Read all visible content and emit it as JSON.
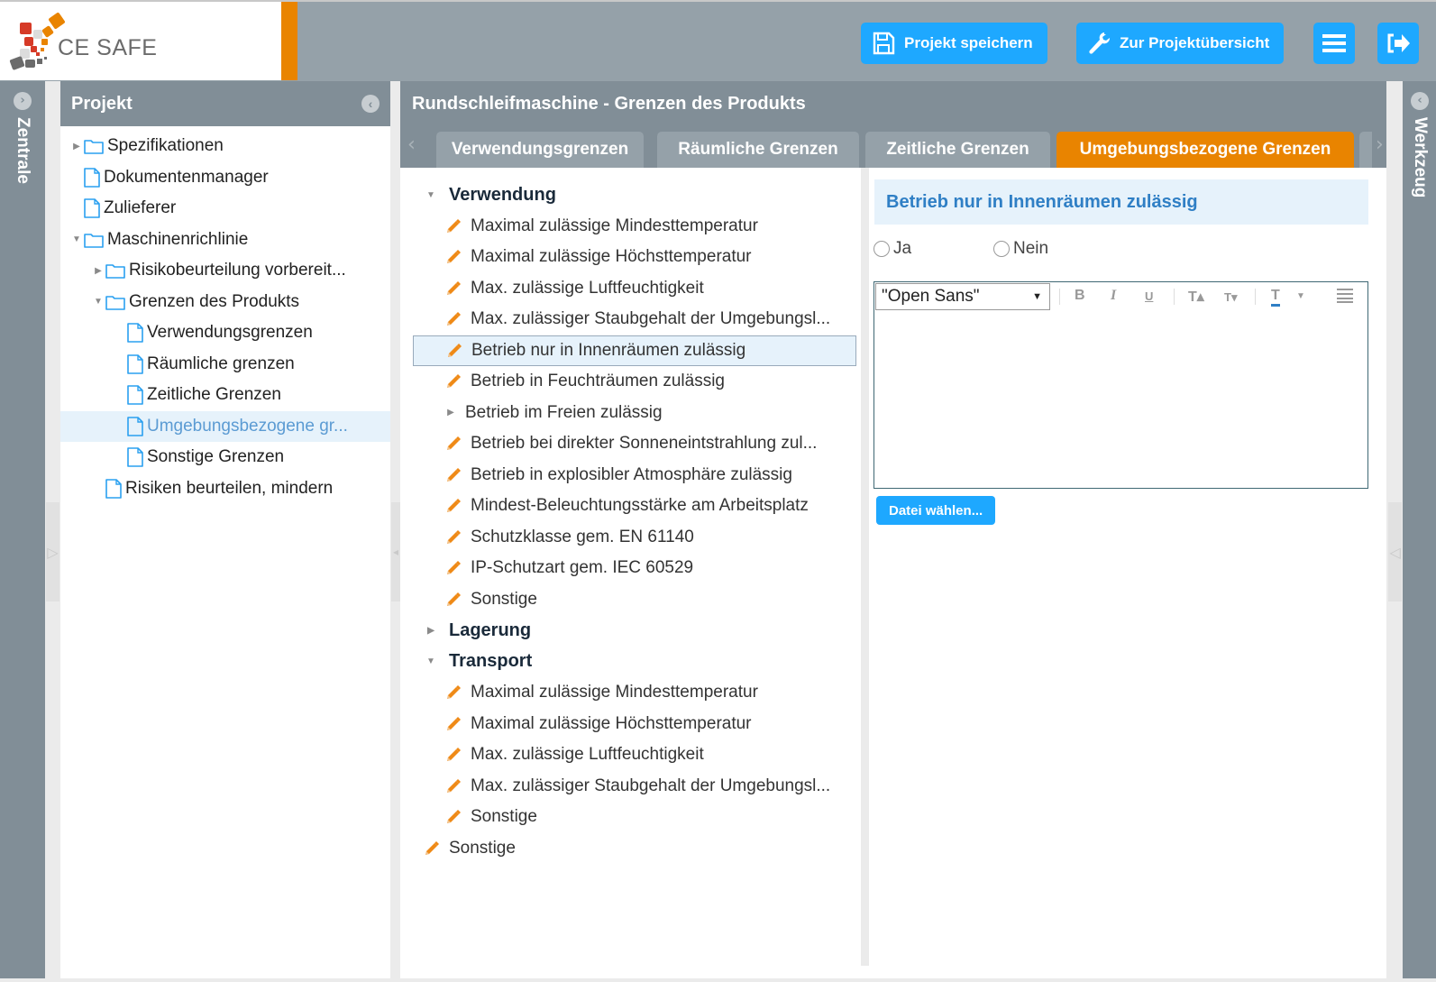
{
  "app": {
    "logo_text": "CE SAFE"
  },
  "toolbar": {
    "save_label": "Projekt speichern",
    "overview_label": "Zur Projektübersicht",
    "menu_icon": "hamburger-menu-icon",
    "logout_icon": "sign-out-icon"
  },
  "left_strip": {
    "label": "Zentrale",
    "toggle_icon": "chevron-right-circle-icon"
  },
  "right_strip": {
    "label": "Werkzeug",
    "toggle_icon": "chevron-left-circle-icon"
  },
  "project_panel": {
    "title": "Projekt",
    "collapse_icon": "chevron-left-circle-icon",
    "tree": [
      {
        "label": "Spezifikationen",
        "type": "folder",
        "level": 0,
        "caret": "collapsed"
      },
      {
        "label": "Dokumentenmanager",
        "type": "file",
        "level": 0,
        "caret": "none"
      },
      {
        "label": "Zulieferer",
        "type": "file",
        "level": 0,
        "caret": "none"
      },
      {
        "label": "Maschinenrichlinie",
        "type": "folder",
        "level": 0,
        "caret": "expanded"
      },
      {
        "label": "Risikobeurteilung vorbereit...",
        "type": "folder",
        "level": 1,
        "caret": "collapsed"
      },
      {
        "label": "Grenzen des Produkts",
        "type": "folder",
        "level": 1,
        "caret": "expanded"
      },
      {
        "label": "Verwendungsgrenzen",
        "type": "file",
        "level": 2,
        "caret": "none"
      },
      {
        "label": "Räumliche grenzen",
        "type": "file",
        "level": 2,
        "caret": "none"
      },
      {
        "label": "Zeitliche Grenzen",
        "type": "file",
        "level": 2,
        "caret": "none"
      },
      {
        "label": "Umgebungsbezogene gr...",
        "type": "file",
        "level": 2,
        "caret": "none",
        "selected": true
      },
      {
        "label": "Sonstige Grenzen",
        "type": "file",
        "level": 2,
        "caret": "none"
      },
      {
        "label": "Risiken beurteilen, mindern",
        "type": "file",
        "level": 1,
        "caret": "none"
      }
    ]
  },
  "main": {
    "title": "Rundschleifmaschine - Grenzen des Produkts",
    "tabs": [
      {
        "label": "Verwendungsgrenzen",
        "active": false
      },
      {
        "label": "Räumliche Grenzen",
        "active": false
      },
      {
        "label": "Zeitliche Grenzen",
        "active": false
      },
      {
        "label": "Umgebungsbezogene Grenzen",
        "active": true
      }
    ],
    "items": [
      {
        "label": "Verwendung",
        "kind": "group",
        "caret": "expanded",
        "level": 0
      },
      {
        "label": "Maximal zulässige Mindesttemperatur",
        "kind": "item",
        "level": 1
      },
      {
        "label": "Maximal zulässige Höchsttemperatur",
        "kind": "item",
        "level": 1
      },
      {
        "label": "Max. zulässige Luftfeuchtigkeit",
        "kind": "item",
        "level": 1
      },
      {
        "label": "Max. zulässiger Staubgehalt der Umgebungsl...",
        "kind": "item",
        "level": 1
      },
      {
        "label": "Betrieb nur in Innenräumen zulässig",
        "kind": "item",
        "level": 1,
        "selected": true
      },
      {
        "label": "Betrieb in Feuchträumen zulässig",
        "kind": "item",
        "level": 1
      },
      {
        "label": "Betrieb im Freien zulässig",
        "kind": "subgroup",
        "caret": "collapsed",
        "level": 1
      },
      {
        "label": "Betrieb bei direkter Sonneneintstrahlung zul...",
        "kind": "item",
        "level": 1
      },
      {
        "label": "Betrieb in explosibler Atmosphäre zulässig",
        "kind": "item",
        "level": 1
      },
      {
        "label": "Mindest-Beleuchtungsstärke am Arbeitsplatz",
        "kind": "item",
        "level": 1
      },
      {
        "label": "Schutzklasse gem. EN 61140",
        "kind": "item",
        "level": 1
      },
      {
        "label": "IP-Schutzart gem. IEC 60529",
        "kind": "item",
        "level": 1
      },
      {
        "label": "Sonstige",
        "kind": "item",
        "level": 1
      },
      {
        "label": "Lagerung",
        "kind": "group",
        "caret": "collapsed",
        "level": 0
      },
      {
        "label": "Transport",
        "kind": "group",
        "caret": "expanded",
        "level": 0
      },
      {
        "label": "Maximal zulässige Mindesttemperatur",
        "kind": "item",
        "level": 1
      },
      {
        "label": "Maximal zulässige Höchsttemperatur",
        "kind": "item",
        "level": 1
      },
      {
        "label": "Max. zulässige Luftfeuchtigkeit",
        "kind": "item",
        "level": 1
      },
      {
        "label": "Max. zulässiger Staubgehalt der Umgebungsl...",
        "kind": "item",
        "level": 1
      },
      {
        "label": "Sonstige",
        "kind": "item",
        "level": 1
      },
      {
        "label": "Sonstige",
        "kind": "item",
        "level": 0
      }
    ]
  },
  "detail": {
    "title": "Betrieb nur in Innenräumen zulässig",
    "radio_yes": "Ja",
    "radio_no": "Nein",
    "editor": {
      "font_value": "\"Open Sans\"",
      "tools": [
        "B",
        "I",
        "U",
        "T▴",
        "T▾",
        "T"
      ],
      "content": ""
    },
    "file_button": "Datei wählen..."
  },
  "colors": {
    "accent_orange": "#e98400",
    "button_blue": "#1ea8ff",
    "header_gray": "#818e97",
    "selection_bg": "#e6f2fb",
    "title_blue": "#2f7fc5"
  }
}
